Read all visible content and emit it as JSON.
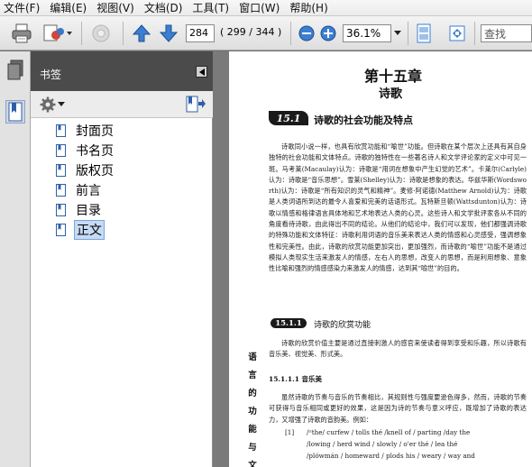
{
  "menu": [
    "文件(F)",
    "编辑(E)",
    "视图(V)",
    "文档(D)",
    "工具(T)",
    "窗口(W)",
    "帮助(H)"
  ],
  "toolbar": {
    "page_number": "284",
    "page_count": "( 299 / 344 )",
    "zoom": "36.1%",
    "search_placeholder": "查找"
  },
  "panel": {
    "title": "书签",
    "bookmarks": [
      "封面页",
      "书名页",
      "版权页",
      "前言",
      "目录",
      "正文"
    ],
    "selected_index": 5
  },
  "doc": {
    "chapter": "第十五章",
    "chapter_sub": "诗歌",
    "section_num": "15.1",
    "section_title": "诗歌的社会功能及特点",
    "para1": "诗歌同小说一样，也具有欣赏功能和“喻世”功能。但诗歌在某个层次上还具有其自身独特的社会功能和文体特点。诗歌的独特性在一些著名诗人和文学评论家的定义中可见一斑。马考莱(Macaulay)认为：诗歌是“用词在想象中产生幻觉的艺术”。卡莱尔(Carlyle)认为：诗歌是“音乐思想”。雪莱(Shelley)认为：诗歌是想象的表达。华兹华斯(Wordsworth)认为：诗歌是“所有知识的灵气和精神”。麦修·阿诺德(Matthew Arnold)认为：诗歌是人类词语所到达的最令人喜爱和完美的话语形式。瓦特斯旦顿(Wattsdunton)认为：诗歌以情感和格律语言具体地和艺术地表达人类的心灵。这些诗人和文学批评家各从不同的角度看待诗歌，由此得出不同的结论。从他们的结论中，我们可以发现，他们都强调诗歌的特殊功能和文体特征：诗歌利用词语的音乐美来表达人类的情感和心灵感受，强调想象性和完美性。由此，诗歌的欣赏功能更加突出，更加强烈，而诗歌的“喻世”功能不是通过模拟人类现实生活来激发人的情感，左右人的思想，改变人的思想，而是利用想象、意象性比喻和强烈的情感感染力来激发人的情感，达到其“喻世”的目的。",
    "subsection_num": "15.1.1",
    "subsection_title": "诗歌的欣赏功能",
    "para2": "诗歌的欣赏价值主要是通过直接刺激人的感官来使读者得到享受和乐趣，所以诗歌有音乐美、视觉美、形式美。",
    "side_text": [
      "语",
      "言",
      "的",
      "功",
      "能",
      "与",
      "文"
    ],
    "h3": "15.1.1.1 音乐美",
    "para3": "虽然诗歌的节奏与音乐的节奏相比，其规则性与强度要逊色得多，然而，诗歌的节奏可获得与音乐相同或更好的效果，这是因为诗的节奏与意义呼应，既增加了诗歌的表达力，又增强了诗歌的音韵美。例如：",
    "example_num": "[1]",
    "example_lines": [
      "/ᶦᶦthe/ curfew / tolls thé /knell of / parting /day the",
      "/lowing / herd wind / slowly / o'er thé / lea thé",
      "/plówmán / homeward / plods his / weary / way and"
    ]
  }
}
